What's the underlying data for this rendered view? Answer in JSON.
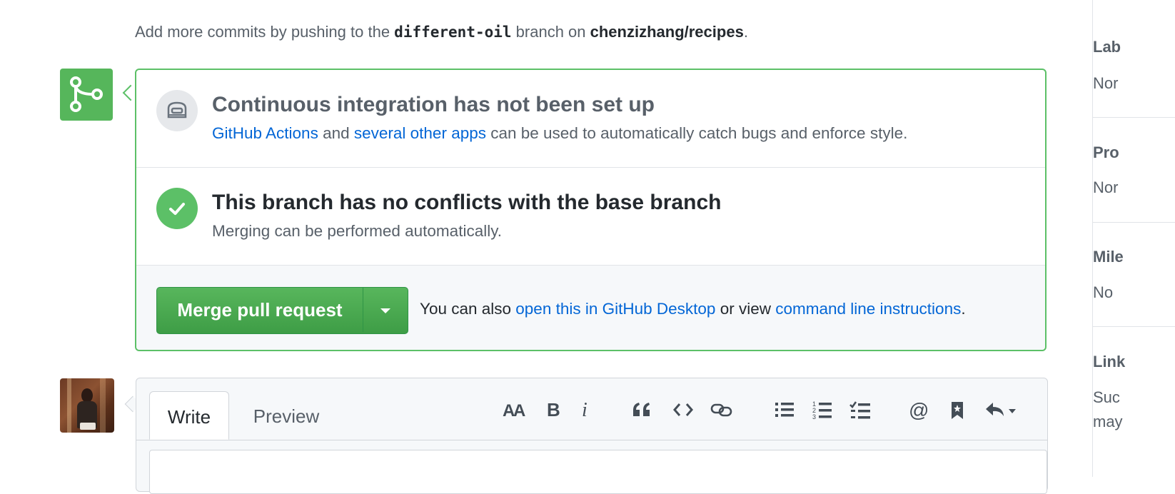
{
  "hint": {
    "prefix": "Add more commits by pushing to the ",
    "branch": "different-oil",
    "middle": " branch on ",
    "repo": "chenzizhang/recipes",
    "suffix": "."
  },
  "ci": {
    "title": "Continuous integration has not been set up",
    "link1": "GitHub Actions",
    "and": " and ",
    "link2": "several other apps",
    "rest": " can be used to automatically catch bugs and enforce style."
  },
  "conflicts": {
    "title": "This branch has no conflicts with the base branch",
    "desc": "Merging can be performed automatically."
  },
  "merge": {
    "button_label": "Merge pull request",
    "alt_prefix": "You can also ",
    "alt_link1": "open this in GitHub Desktop",
    "alt_middle": " or view ",
    "alt_link2": "command line instructions",
    "alt_suffix": "."
  },
  "comment": {
    "tabs": [
      {
        "label": "Write",
        "active": true
      },
      {
        "label": "Preview",
        "active": false
      }
    ],
    "toolbar": [
      "text-size-icon",
      "bold-icon",
      "italic-icon",
      "quote-icon",
      "code-icon",
      "link-icon",
      "bulleted-list-icon",
      "numbered-list-icon",
      "task-list-icon",
      "mention-icon",
      "reference-icon",
      "reply-icon"
    ]
  },
  "sidebar": {
    "sections": [
      {
        "title": "Lab",
        "value": "Nor"
      },
      {
        "title": "Pro",
        "value": "Nor"
      },
      {
        "title": "Mile",
        "value": "No"
      },
      {
        "title": "Link",
        "value": "Suc",
        "value2": "may"
      }
    ]
  },
  "colors": {
    "green": "#5cc067",
    "link": "#0366d6",
    "muted": "#586069"
  }
}
